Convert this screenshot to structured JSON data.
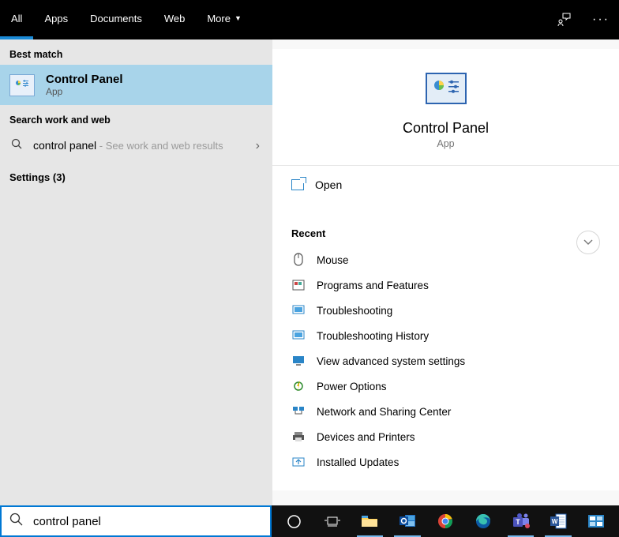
{
  "tabs": {
    "all": "All",
    "apps": "Apps",
    "documents": "Documents",
    "web": "Web",
    "more": "More"
  },
  "sections": {
    "best_match": "Best match",
    "search_work_web": "Search work and web",
    "settings": "Settings (3)"
  },
  "best_match": {
    "title": "Control Panel",
    "subtitle": "App"
  },
  "web_search": {
    "query": "control panel",
    "hint": " - See work and web results"
  },
  "preview": {
    "title": "Control Panel",
    "subtitle": "App"
  },
  "actions": {
    "open": "Open"
  },
  "recent": {
    "title": "Recent",
    "items": [
      {
        "label": "Mouse"
      },
      {
        "label": "Programs and Features"
      },
      {
        "label": "Troubleshooting"
      },
      {
        "label": "Troubleshooting History"
      },
      {
        "label": "View advanced system settings"
      },
      {
        "label": "Power Options"
      },
      {
        "label": "Network and Sharing Center"
      },
      {
        "label": "Devices and Printers"
      },
      {
        "label": "Installed Updates"
      }
    ]
  },
  "search": {
    "value": "control panel"
  }
}
